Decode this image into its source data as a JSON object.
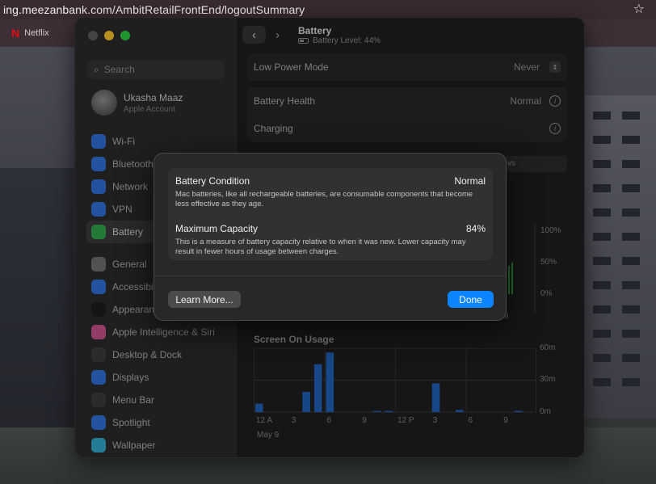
{
  "browser": {
    "url": "ing.meezanbank.com/AmbitRetailFrontEnd/logoutSummary",
    "star_icon": "star-icon",
    "bookmark": {
      "logo": "N",
      "label": "Netflix"
    }
  },
  "sidebar": {
    "search_placeholder": "Search",
    "account": {
      "name": "Ukasha Maaz",
      "subtitle": "Apple Account"
    },
    "items": [
      {
        "label": "Wi-Fi",
        "icon": "wifi-icon",
        "color": "#2f6fd6",
        "active": false
      },
      {
        "label": "Bluetooth",
        "icon": "bluetooth-icon",
        "color": "#2f6fd6",
        "active": false
      },
      {
        "label": "Network",
        "icon": "globe-icon",
        "color": "#2f6fd6",
        "active": false
      },
      {
        "label": "VPN",
        "icon": "vpn-icon",
        "color": "#2f6fd6",
        "active": false
      },
      {
        "label": "Battery",
        "icon": "battery-icon",
        "color": "#31a34a",
        "active": true
      },
      {
        "label": "General",
        "icon": "gear-icon",
        "color": "#6e6e72",
        "active": false
      },
      {
        "label": "Accessibility",
        "icon": "accessibility-icon",
        "color": "#2f6fd6",
        "active": false
      },
      {
        "label": "Appearance",
        "icon": "appearance-icon",
        "color": "#1c1c1e",
        "active": false
      },
      {
        "label": "Apple Intelligence & Siri",
        "icon": "siri-icon",
        "color": "#c4508a",
        "active": false
      },
      {
        "label": "Desktop & Dock",
        "icon": "dock-icon",
        "color": "#3a3a3c",
        "active": false
      },
      {
        "label": "Displays",
        "icon": "display-icon",
        "color": "#2f6fd6",
        "active": false
      },
      {
        "label": "Menu Bar",
        "icon": "menubar-icon",
        "color": "#3a3a3c",
        "active": false
      },
      {
        "label": "Spotlight",
        "icon": "spotlight-icon",
        "color": "#2f6fd6",
        "active": false
      },
      {
        "label": "Wallpaper",
        "icon": "wallpaper-icon",
        "color": "#2fa4c8",
        "active": false
      }
    ]
  },
  "main": {
    "title": "Battery",
    "battery_level": "Battery Level: 44%",
    "rows": {
      "low_power": {
        "label": "Low Power Mode",
        "value": "Never"
      },
      "health": {
        "label": "Battery Health",
        "value": "Normal"
      },
      "charging": {
        "label": "Charging",
        "value": ""
      }
    },
    "tab_strip_text": "vs",
    "level_axis": [
      "100%",
      "50%",
      "0%"
    ],
    "level_tick": "9",
    "chart": {
      "title": "Screen On Usage",
      "y_ticks": [
        "60m",
        "30m",
        "0m"
      ],
      "x_ticks": [
        "12 A",
        "3",
        "6",
        "9",
        "12 P",
        "3",
        "6",
        "9"
      ],
      "date": "May 9"
    }
  },
  "chart_data": {
    "type": "bar",
    "title": "Screen On Usage",
    "ylabel": "",
    "xlabel": "",
    "ylim": [
      0,
      60
    ],
    "y_unit": "minutes",
    "categories": [
      "0",
      "1",
      "2",
      "3",
      "4",
      "5",
      "6",
      "7",
      "8",
      "9",
      "10",
      "11",
      "12",
      "13",
      "14",
      "15",
      "16",
      "17",
      "18",
      "19",
      "20",
      "21",
      "22",
      "23"
    ],
    "values": [
      8,
      0,
      0,
      0,
      19,
      45,
      56,
      0,
      0,
      0,
      1,
      1,
      0,
      0,
      0,
      27,
      0,
      2,
      0,
      0,
      0,
      0,
      1,
      0
    ],
    "bar_color": "#1f5fb3"
  },
  "sheet": {
    "condition": {
      "title": "Battery Condition",
      "value": "Normal",
      "desc": "Mac batteries, like all rechargeable batteries, are consumable components that become less effective as they age."
    },
    "capacity": {
      "title": "Maximum Capacity",
      "value": "84%",
      "desc": "This is a measure of battery capacity relative to when it was new. Lower capacity may result in fewer hours of usage between charges."
    },
    "learn_more": "Learn More...",
    "done": "Done",
    "done_color": "#0a84ff"
  }
}
